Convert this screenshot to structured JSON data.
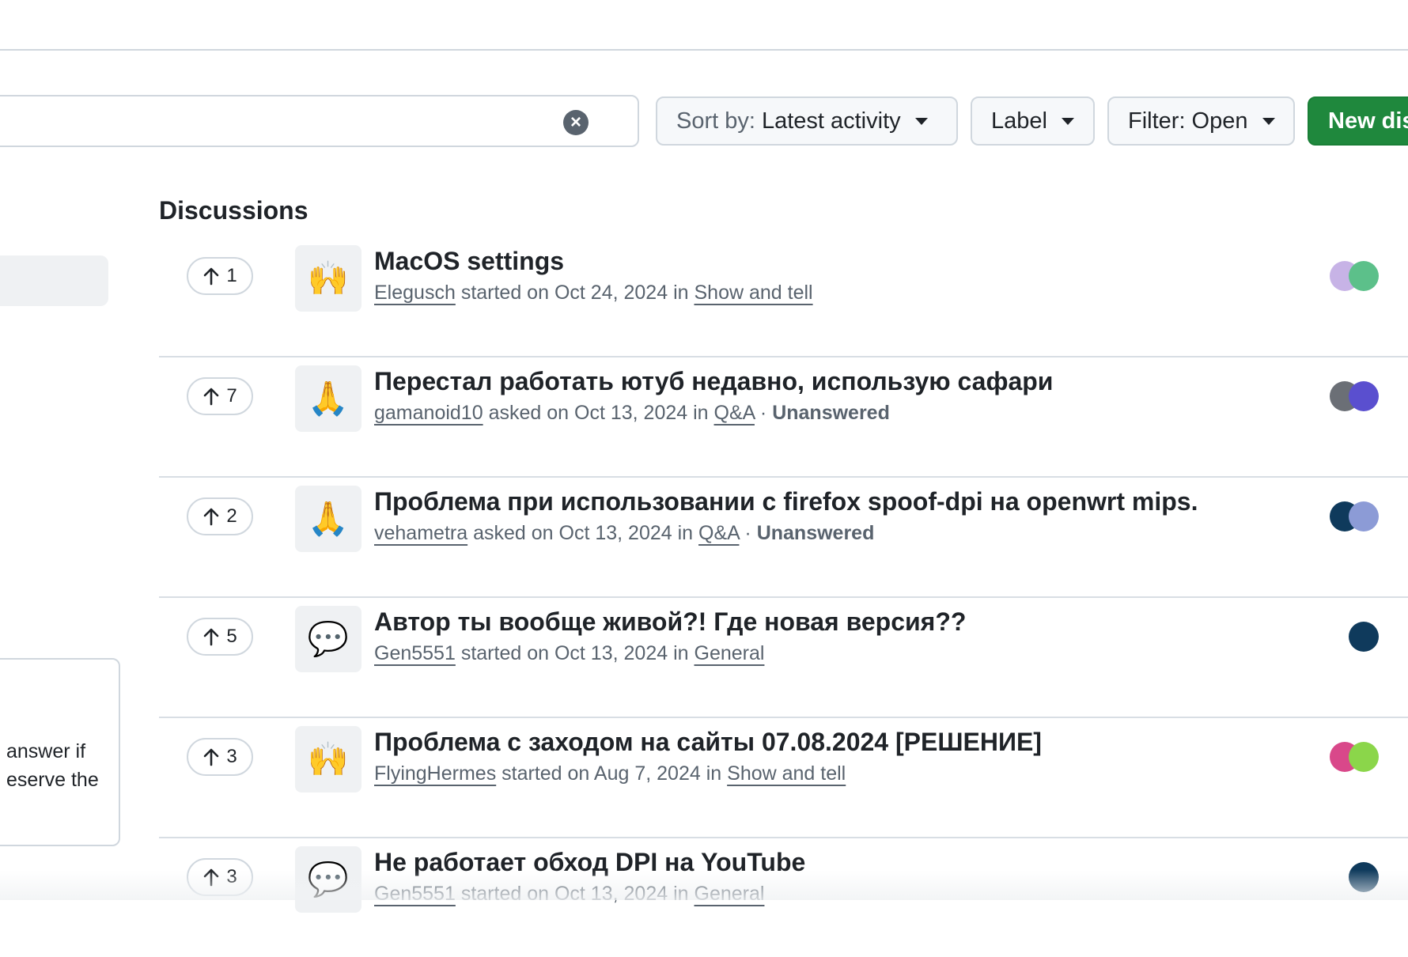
{
  "search": {
    "value": "",
    "clear_icon": "x-circle-icon"
  },
  "toolbar": {
    "sort_prefix": "Sort by:",
    "sort_value": "Latest activity",
    "label": "Label",
    "filter": "Filter: Open",
    "new_discussion": "New dis"
  },
  "sidebar": {
    "card_text_line1": "answer if",
    "card_text_line2": "eserve the"
  },
  "discussions": {
    "heading": "Discussions",
    "items": [
      {
        "votes": "1",
        "emoji": "🙌",
        "title": "MacOS settings",
        "author": "Elegusch",
        "verb": "started on",
        "date": "Oct 24, 2024",
        "category": "Show and tell",
        "status": "",
        "avatar_colors": [
          "#c7b3e6",
          "#5cc08a"
        ]
      },
      {
        "votes": "7",
        "emoji": "🙏",
        "title": "Перестал работать ютуб недавно, использую сафари",
        "author": "gamanoid10",
        "verb": "asked on",
        "date": "Oct 13, 2024",
        "category": "Q&A",
        "status": "Unanswered",
        "avatar_colors": [
          "#6b6f76",
          "#5a4fcf"
        ]
      },
      {
        "votes": "2",
        "emoji": "🙏",
        "title": "Проблема при использовании с firefox spoof-dpi на openwrt mips.",
        "author": "vehametra",
        "verb": "asked on",
        "date": "Oct 13, 2024",
        "category": "Q&A",
        "status": "Unanswered",
        "avatar_colors": [
          "#0f3a5c",
          "#8c9bd6"
        ]
      },
      {
        "votes": "5",
        "emoji": "💬",
        "title": "Автор ты вообще живой?! Где новая версия??",
        "author": "Gen5551",
        "verb": "started on",
        "date": "Oct 13, 2024",
        "category": "General",
        "status": "",
        "avatar_colors": [
          "#0f3a5c",
          "#0f3a5c"
        ]
      },
      {
        "votes": "3",
        "emoji": "🙌",
        "title": "Проблема с заходом на сайты 07.08.2024 [РЕШЕНИЕ]",
        "author": "FlyingHermes",
        "verb": "started on",
        "date": "Aug 7, 2024",
        "category": "Show and tell",
        "status": "",
        "avatar_colors": [
          "#d9488a",
          "#8bd64a"
        ]
      },
      {
        "votes": "3",
        "emoji": "💬",
        "title": "Не работает обход DPI на YouTube",
        "author": "Gen5551",
        "verb": "started on",
        "date": "Oct 13, 2024",
        "category": "General",
        "status": "",
        "avatar_colors": [
          "#0f3a5c",
          "#0f3a5c"
        ]
      }
    ]
  },
  "words": {
    "in": "in",
    "dot": "·"
  }
}
